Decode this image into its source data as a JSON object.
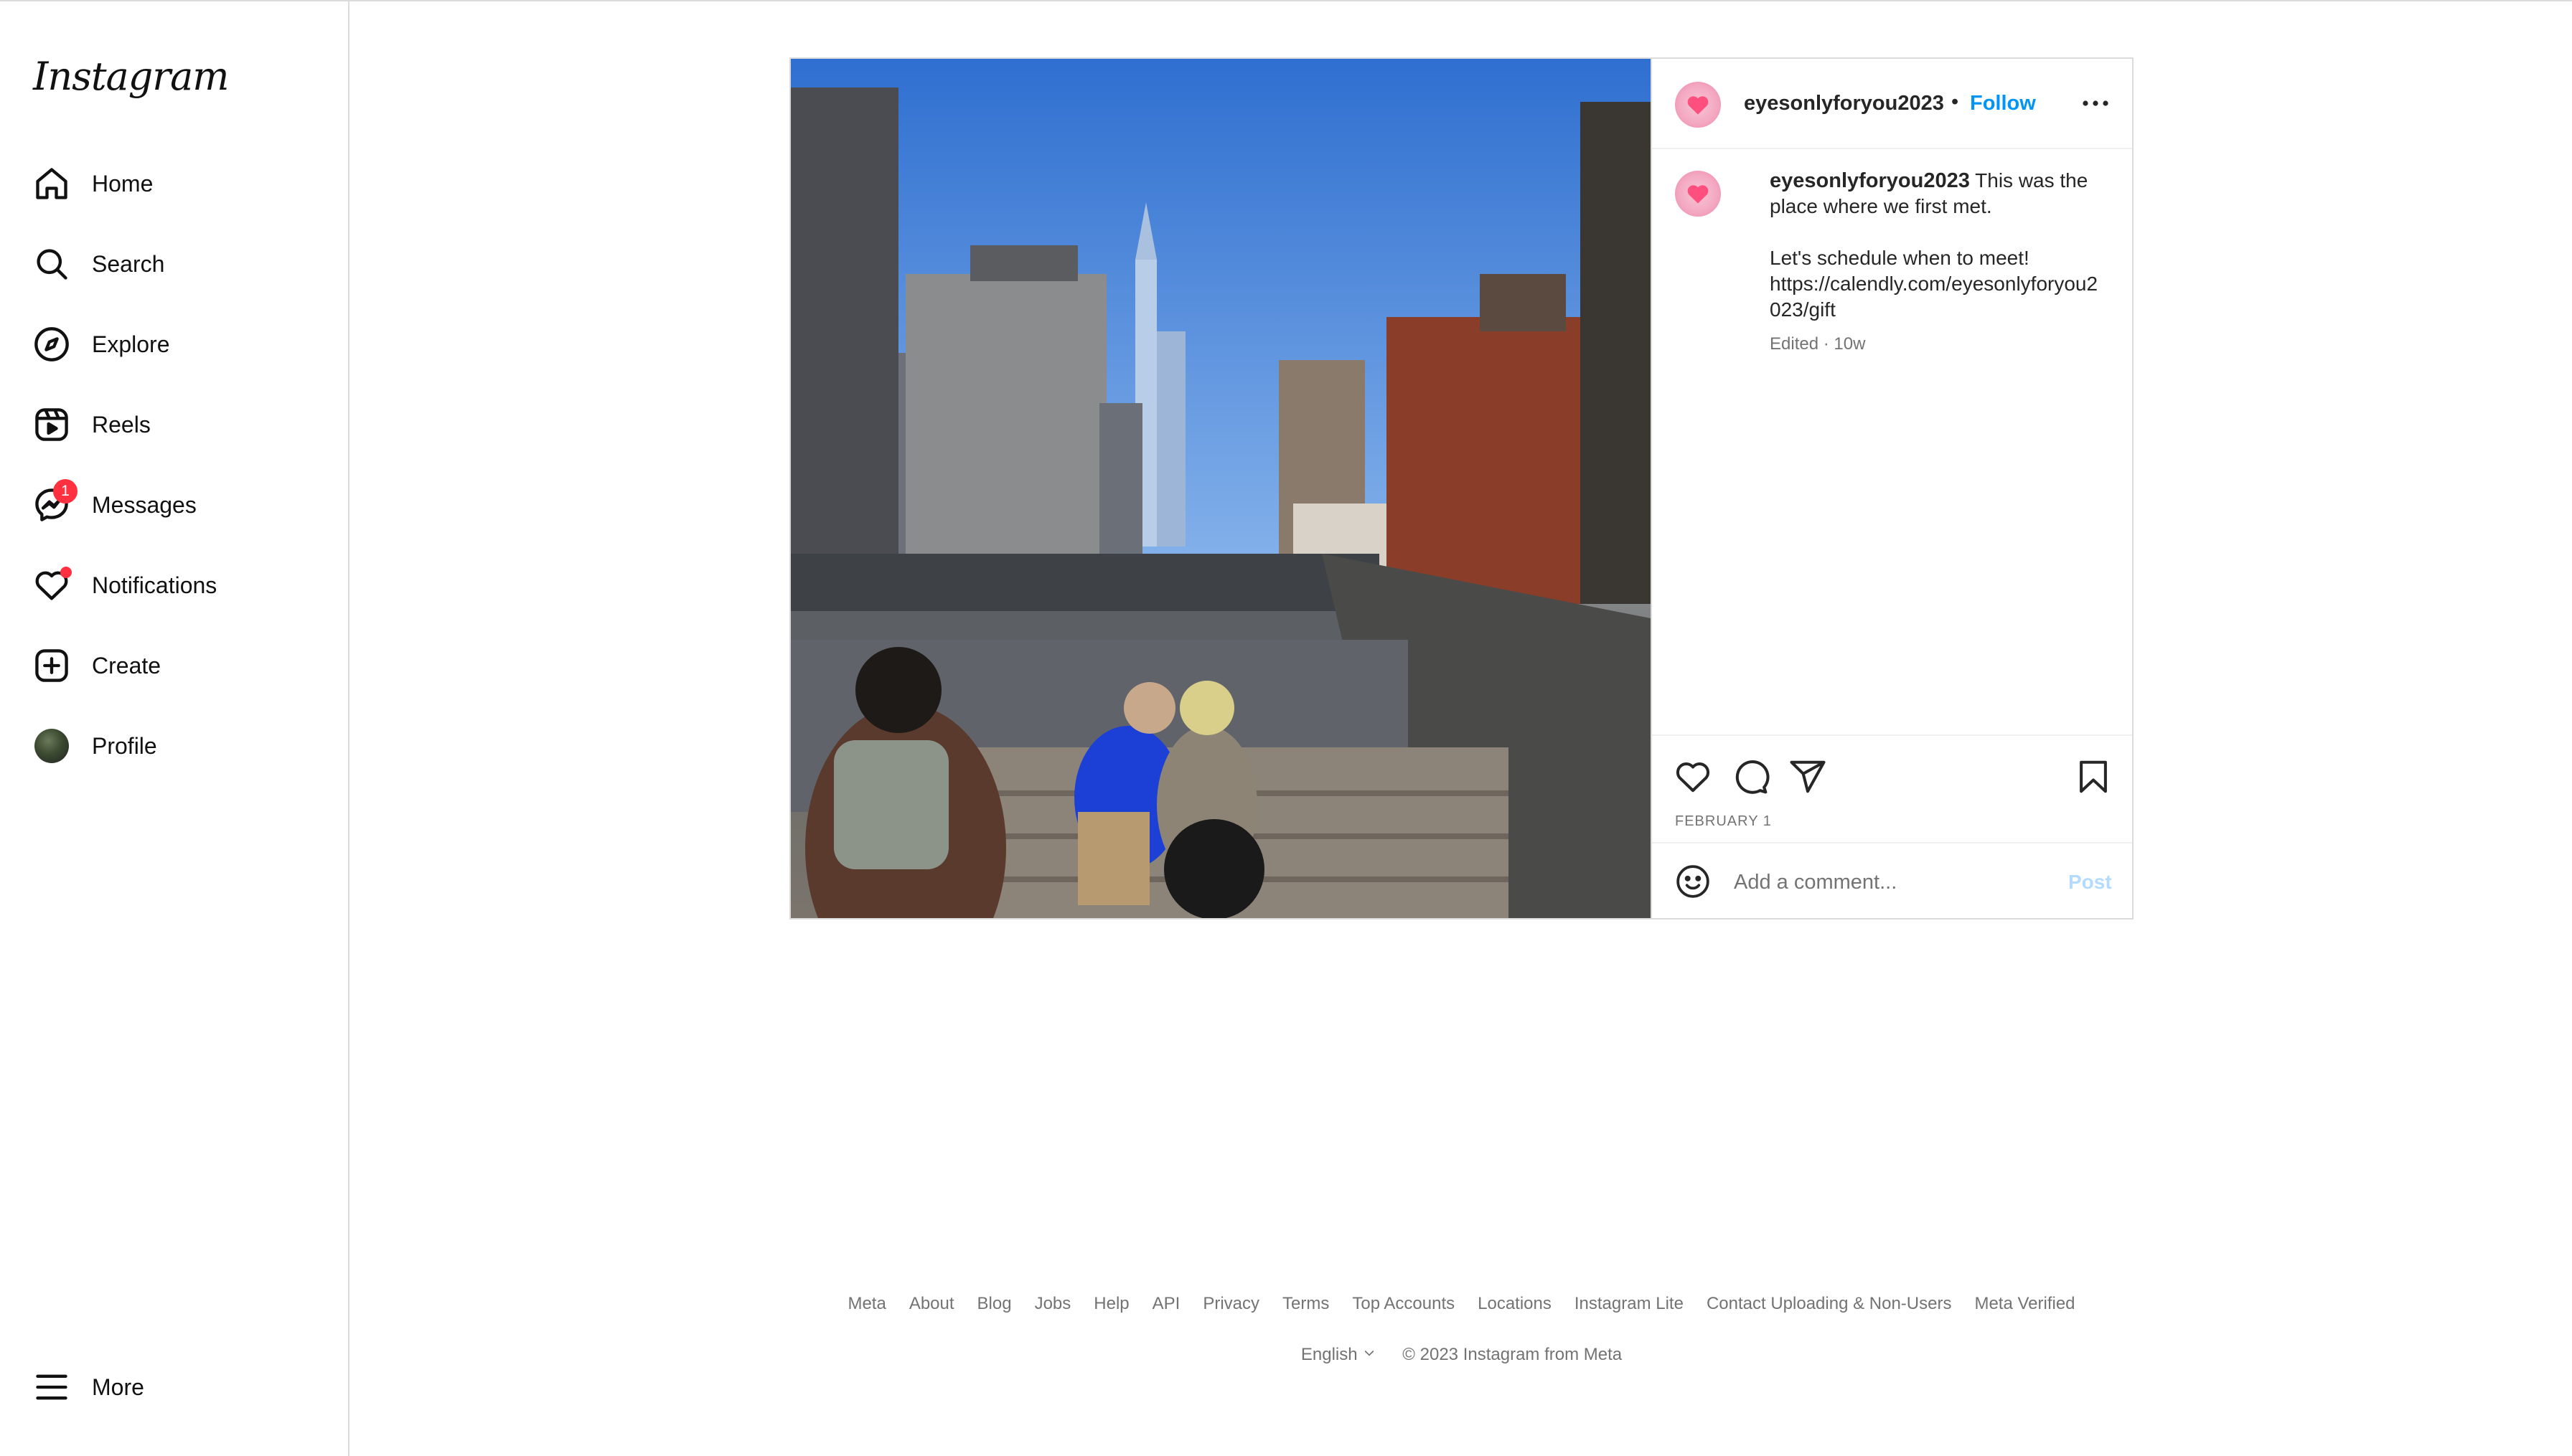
{
  "app": {
    "logo_text": "Instagram"
  },
  "sidebar": {
    "items": [
      {
        "label": "Home",
        "icon": "home-icon"
      },
      {
        "label": "Search",
        "icon": "search-icon"
      },
      {
        "label": "Explore",
        "icon": "compass-icon"
      },
      {
        "label": "Reels",
        "icon": "reels-icon"
      },
      {
        "label": "Messages",
        "icon": "messenger-icon",
        "badge": "1"
      },
      {
        "label": "Notifications",
        "icon": "heart-icon"
      },
      {
        "label": "Create",
        "icon": "plus-square-icon"
      },
      {
        "label": "Profile",
        "icon": "avatar"
      }
    ],
    "more_label": "More"
  },
  "post": {
    "username": "eyesonlyforyou2023",
    "separator": "•",
    "follow_label": "Follow",
    "caption_line1": "This was the place where we first met.",
    "caption_line2": "Let's schedule when to meet!",
    "caption_line3": "https://calendly.com/eyesonlyforyou2023/gift",
    "meta": "Edited · 10w",
    "date": "FEBRUARY 1",
    "comment_placeholder": "Add a comment...",
    "post_label": "Post"
  },
  "footer": {
    "links": [
      "Meta",
      "About",
      "Blog",
      "Jobs",
      "Help",
      "API",
      "Privacy",
      "Terms",
      "Top Accounts",
      "Locations",
      "Instagram Lite",
      "Contact Uploading & Non-Users",
      "Meta Verified"
    ],
    "language": "English",
    "copyright": "© 2023 Instagram from Meta"
  },
  "colors": {
    "accent": "#0095f6",
    "badge": "#ff3040",
    "muted": "#737373"
  }
}
